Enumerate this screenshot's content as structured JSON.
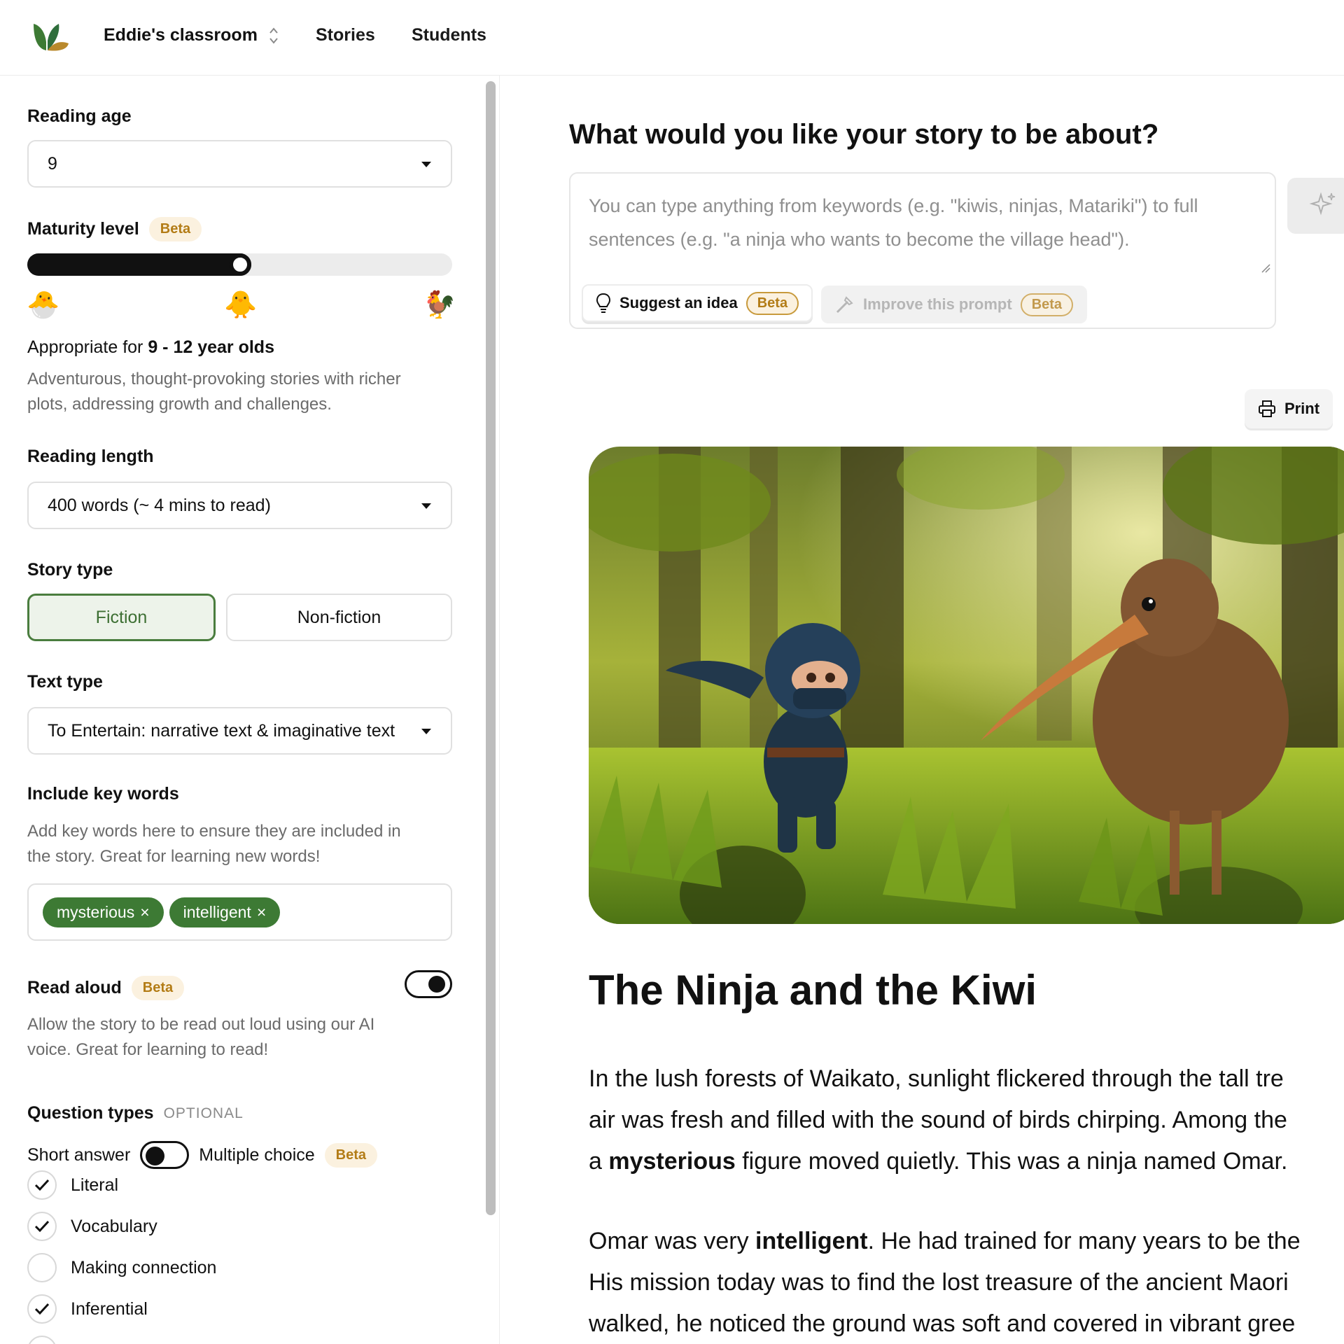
{
  "header": {
    "classroom": "Eddie's classroom",
    "nav": [
      "Stories",
      "Students"
    ]
  },
  "sidebar": {
    "reading_age": {
      "label": "Reading age",
      "value": "9"
    },
    "maturity": {
      "label": "Maturity level",
      "badge": "Beta",
      "level_fraction": 0.5,
      "icons": [
        "🐣",
        "🐥",
        "🐓"
      ],
      "appropriate_prefix": "Appropriate for ",
      "appropriate_range": "9 - 12 year olds",
      "description_lines": [
        "Adventurous, thought-provoking stories with richer",
        "plots, addressing growth and challenges."
      ]
    },
    "reading_length": {
      "label": "Reading length",
      "value": "400 words (~ 4 mins to read)"
    },
    "story_type": {
      "label": "Story type",
      "options": [
        "Fiction",
        "Non-fiction"
      ],
      "selected": "Fiction"
    },
    "text_type": {
      "label": "Text type",
      "value": "To Entertain: narrative text & imaginative text"
    },
    "key_words": {
      "label": "Include key words",
      "description_lines": [
        "Add key words here to ensure they are included in",
        "the story. Great for learning new words!"
      ],
      "chips": [
        "mysterious",
        "intelligent"
      ],
      "remove_glyph": "×"
    },
    "read_aloud": {
      "label": "Read aloud",
      "badge": "Beta",
      "enabled": true,
      "description_lines": [
        "Allow the story to be read out loud using our AI",
        "voice. Great for learning to read!"
      ]
    },
    "question_types": {
      "label": "Question types",
      "optional": "OPTIONAL",
      "short_answer": "Short answer",
      "multiple_choice": "Multiple choice",
      "badge": "Beta",
      "items": [
        {
          "label": "Literal",
          "checked": true
        },
        {
          "label": "Vocabulary",
          "checked": true
        },
        {
          "label": "Making connection",
          "checked": false
        },
        {
          "label": "Inferential",
          "checked": true
        }
      ]
    }
  },
  "main": {
    "question": "What would you like your story to be about?",
    "prompt_placeholder_lines": [
      "You can type anything from keywords (e.g. \"kiwis, ninjas, Matariki\") to full",
      "sentences (e.g. \"a ninja who wants to become the village head\")."
    ],
    "suggest_label": "Suggest an idea",
    "improve_label": "Improve this prompt",
    "badge": "Beta",
    "print_label": "Print",
    "story": {
      "title": "The Ninja and the Kiwi",
      "p1": {
        "line1": "In the lush forests of Waikato, sunlight flickered through the tall tre",
        "line2": "air was fresh and filled with the sound of birds chirping. Among the",
        "line3_pre": "a ",
        "line3_bold": "mysterious",
        "line3_post": " figure moved quietly. This was a ninja named Omar."
      },
      "p2": {
        "line1_pre": "Omar was very ",
        "line1_bold": "intelligent",
        "line1_post": ". He had trained for many years to be the",
        "line2": "His mission today was to find the lost treasure of the ancient Maori",
        "line3": "walked, he noticed the ground was soft and covered in vibrant gree"
      }
    }
  },
  "colors": {
    "accent_green": "#3d7a34",
    "beta_bg": "#fbf1df",
    "beta_text": "#b37c16"
  }
}
